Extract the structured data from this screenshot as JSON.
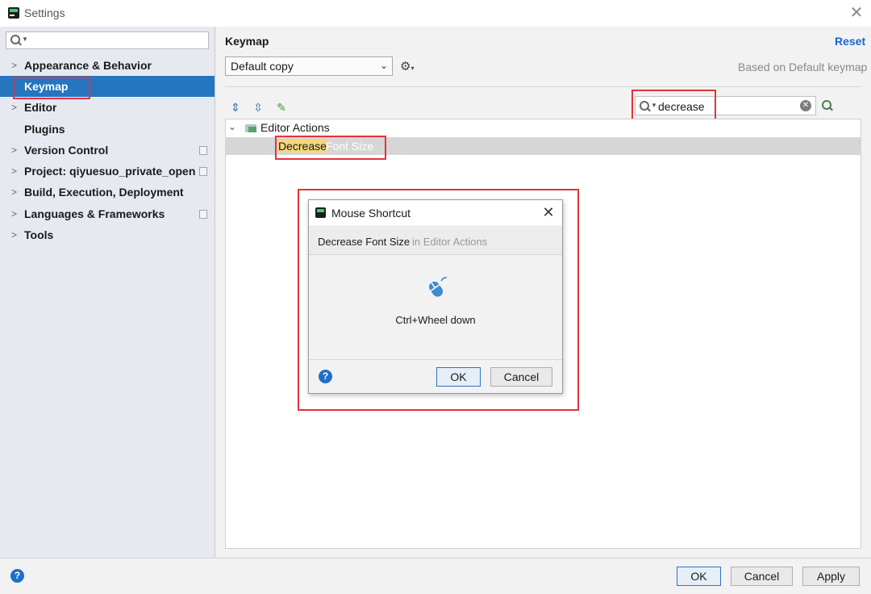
{
  "window": {
    "title": "Settings"
  },
  "sidebar": {
    "search_value": "",
    "items": [
      {
        "label": "Appearance & Behavior",
        "expandable": true,
        "copy_icon": false
      },
      {
        "label": "Keymap",
        "expandable": false,
        "selected": true,
        "copy_icon": false
      },
      {
        "label": "Editor",
        "expandable": true,
        "copy_icon": false
      },
      {
        "label": "Plugins",
        "expandable": false,
        "copy_icon": false
      },
      {
        "label": "Version Control",
        "expandable": true,
        "copy_icon": true
      },
      {
        "label": "Project: qiyuesuo_private_open...",
        "expandable": true,
        "copy_icon": true
      },
      {
        "label": "Build, Execution, Deployment",
        "expandable": true,
        "copy_icon": false
      },
      {
        "label": "Languages & Frameworks",
        "expandable": true,
        "copy_icon": true
      },
      {
        "label": "Tools",
        "expandable": true,
        "copy_icon": false
      }
    ]
  },
  "keymap": {
    "title": "Keymap",
    "reset_label": "Reset",
    "selected_keymap": "Default copy",
    "based_on": "Based on Default keymap",
    "search_value": "decrease",
    "tree": {
      "group": "Editor Actions",
      "action_match": "Decrease",
      "action_rest": " Font Size"
    }
  },
  "dialog": {
    "title": "Mouse Shortcut",
    "action_name": "Decrease Font Size",
    "action_group": " in Editor Actions",
    "shortcut": "Ctrl+Wheel down",
    "ok_label": "OK",
    "cancel_label": "Cancel",
    "help_label": "?"
  },
  "footer": {
    "help_label": "?",
    "ok_label": "OK",
    "cancel_label": "Cancel",
    "apply_label": "Apply"
  },
  "icons": {
    "app": "pycharm-logo-icon",
    "search": "search-icon",
    "gear": "gear-icon",
    "expand_all": "expand-all-icon",
    "collapse_all": "collapse-all-icon",
    "edit": "pencil-icon",
    "clear": "clear-icon",
    "find_shortcut": "find-by-shortcut-icon",
    "mouse": "mouse-icon"
  },
  "colors": {
    "selection": "#2675bf",
    "highlight_box": "#e5323c",
    "link": "#1768c9",
    "search_match": "#f2d77c"
  }
}
